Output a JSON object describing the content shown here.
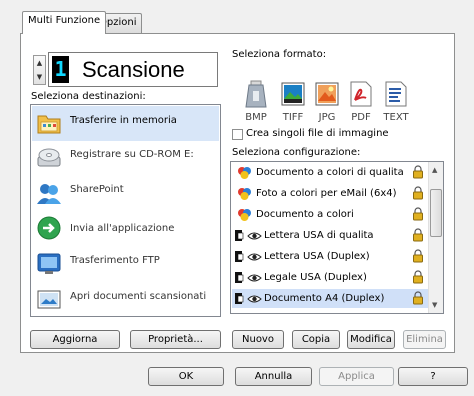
{
  "tabs": [
    {
      "label": "Multi Funzione",
      "active": true
    },
    {
      "label": "Opzioni",
      "active": false
    }
  ],
  "scan": {
    "number": "1",
    "title": "Scansione"
  },
  "labels": {
    "destinations": "Seleziona destinazioni:",
    "format": "Seleziona formato:",
    "separate_files": "Crea singoli file di immagine",
    "configuration": "Seleziona configurazione:"
  },
  "destinations": [
    {
      "label": "Trasferire in memoria",
      "icon": "folder-icon",
      "selected": true
    },
    {
      "label": "Registrare su CD-ROM  E:",
      "icon": "cd-rom-icon",
      "selected": false
    },
    {
      "label": "SharePoint",
      "icon": "sharepoint-icon",
      "selected": false
    },
    {
      "label": "Invia all'applicazione",
      "icon": "send-to-app-icon",
      "selected": false
    },
    {
      "label": "Trasferimento FTP",
      "icon": "ftp-icon",
      "selected": false
    },
    {
      "label": "Apri documenti scansionati",
      "icon": "open-document-icon",
      "selected": false
    }
  ],
  "formats": [
    {
      "label": "BMP",
      "icon": "bmp-icon",
      "color": "#6e7a88"
    },
    {
      "label": "TIFF",
      "icon": "tiff-icon",
      "color": "#1a7fc4"
    },
    {
      "label": "JPG",
      "icon": "jpg-icon",
      "color": "#e25b1d"
    },
    {
      "label": "PDF",
      "icon": "pdf-icon",
      "color": "#d0242b"
    },
    {
      "label": "TEXT",
      "icon": "text-icon",
      "color": "#2c5ca8"
    }
  ],
  "configurations": [
    {
      "label": "Documento a colori di qualita",
      "type": "color",
      "selected": false
    },
    {
      "label": "Foto a colori per eMail (6x4)",
      "type": "color",
      "selected": false
    },
    {
      "label": "Documento a colori",
      "type": "color",
      "selected": false
    },
    {
      "label": "Lettera USA di qualita",
      "type": "bw",
      "selected": false
    },
    {
      "label": "Lettera USA (Duplex)",
      "type": "bw",
      "selected": false
    },
    {
      "label": "Legale USA (Duplex)",
      "type": "bw",
      "selected": false
    },
    {
      "label": "Documento A4 (Duplex)",
      "type": "bw",
      "selected": true
    }
  ],
  "buttons": {
    "refresh": "Aggiorna",
    "properties": "Proprietà...",
    "new": "Nuovo",
    "copy": "Copia",
    "edit": "Modifica",
    "delete": "Elimina",
    "ok": "OK",
    "cancel": "Annulla",
    "apply": "Applica",
    "help": "?"
  },
  "colors": {
    "selected_bg": "#d8e6f8",
    "lcd_bg": "#000000",
    "lcd_digit": "#10d8ff",
    "lock": "#e0b020"
  }
}
